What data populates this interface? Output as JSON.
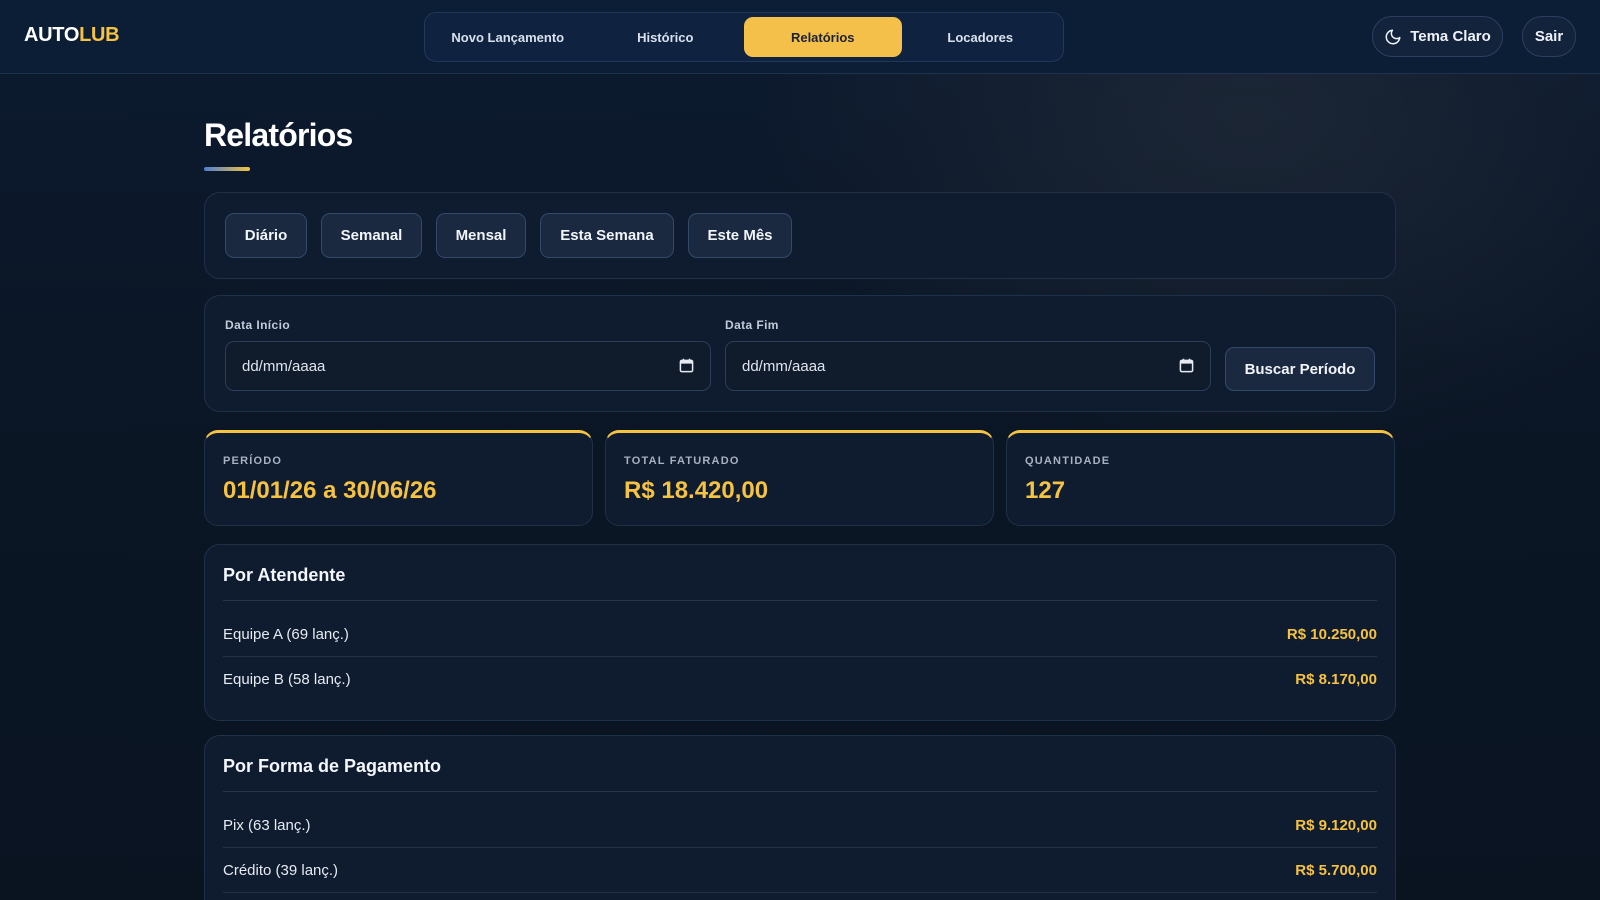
{
  "header": {
    "logo_part1": "AUTO",
    "logo_part2": "LUB",
    "nav": [
      {
        "label": "Novo Lançamento",
        "active": false
      },
      {
        "label": "Histórico",
        "active": false
      },
      {
        "label": "Relatórios",
        "active": true
      },
      {
        "label": "Locadores",
        "active": false
      }
    ],
    "theme_label": "Tema Claro",
    "theme_icon": "moon-icon",
    "logout_label": "Sair"
  },
  "page": {
    "title": "Relatórios"
  },
  "filters": {
    "buttons": [
      "Diário",
      "Semanal",
      "Mensal",
      "Esta Semana",
      "Este Mês"
    ]
  },
  "date_range": {
    "start_label": "Data Início",
    "start_placeholder": "dd/mm/aaaa",
    "end_label": "Data Fim",
    "end_placeholder": "dd/mm/aaaa",
    "search_label": "Buscar Período",
    "calendar_icon": "calendar-icon"
  },
  "stats": [
    {
      "label": "PERÍODO",
      "value": "01/01/26 a 30/06/26"
    },
    {
      "label": "TOTAL FATURADO",
      "value": "R$ 18.420,00"
    },
    {
      "label": "QUANTIDADE",
      "value": "127"
    }
  ],
  "by_attendant": {
    "title": "Por Atendente",
    "rows": [
      {
        "name": "Equipe A (69 lanç.)",
        "amount": "R$ 10.250,00"
      },
      {
        "name": "Equipe B (58 lanç.)",
        "amount": "R$ 8.170,00"
      }
    ]
  },
  "by_payment": {
    "title": "Por Forma de Pagamento",
    "rows": [
      {
        "name": "Pix (63 lanç.)",
        "amount": "R$ 9.120,00"
      },
      {
        "name": "Crédito (39 lanç.)",
        "amount": "R$ 5.700,00"
      }
    ]
  },
  "colors": {
    "accent": "#f5c242",
    "background": "#0b1626",
    "card": "#0f1b2e"
  }
}
